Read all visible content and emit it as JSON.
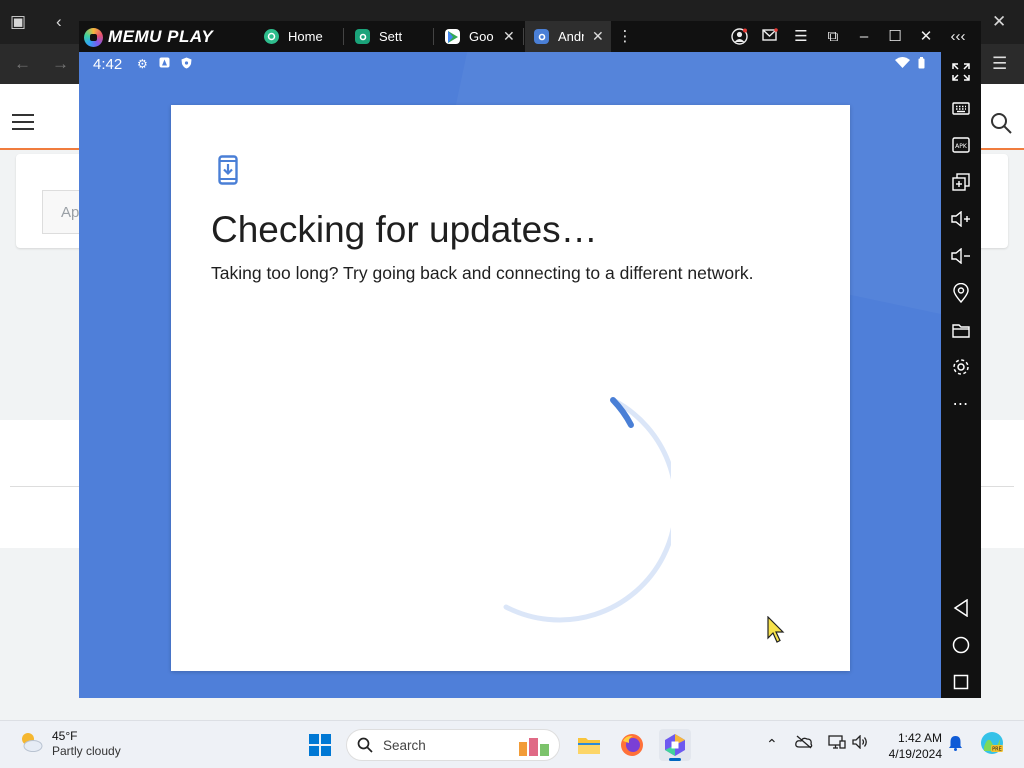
{
  "memu": {
    "brand": "MEMU PLAY",
    "tabs": [
      {
        "label": "Home",
        "color": "#2ebd8d"
      },
      {
        "label": "Sett",
        "color": "#1aa37a"
      },
      {
        "label": "Goo",
        "color": "#ffffff"
      },
      {
        "label": "Andr",
        "color": "#4a7fd6"
      }
    ],
    "accent": "#3ed4a0"
  },
  "android": {
    "status_time": "4:42",
    "background": "#4f7fd9",
    "title": "Checking for updates…",
    "subtitle": "Taking too long? Try going back and connecting to a different network."
  },
  "sidebar_icons": [
    "fullscreen-icon",
    "keyboard-icon",
    "apk-icon",
    "multi-window-icon",
    "volume-up-icon",
    "volume-down-icon",
    "location-icon",
    "folder-icon",
    "settings-icon",
    "more-icon",
    "back-icon",
    "home-icon",
    "recents-icon"
  ],
  "background_browser": {
    "input_placeholder": "Ap"
  },
  "taskbar": {
    "weather_temp": "45°F",
    "weather_desc": "Partly cloudy",
    "search_placeholder": "Search",
    "time": "1:42 AM",
    "date": "4/19/2024"
  }
}
